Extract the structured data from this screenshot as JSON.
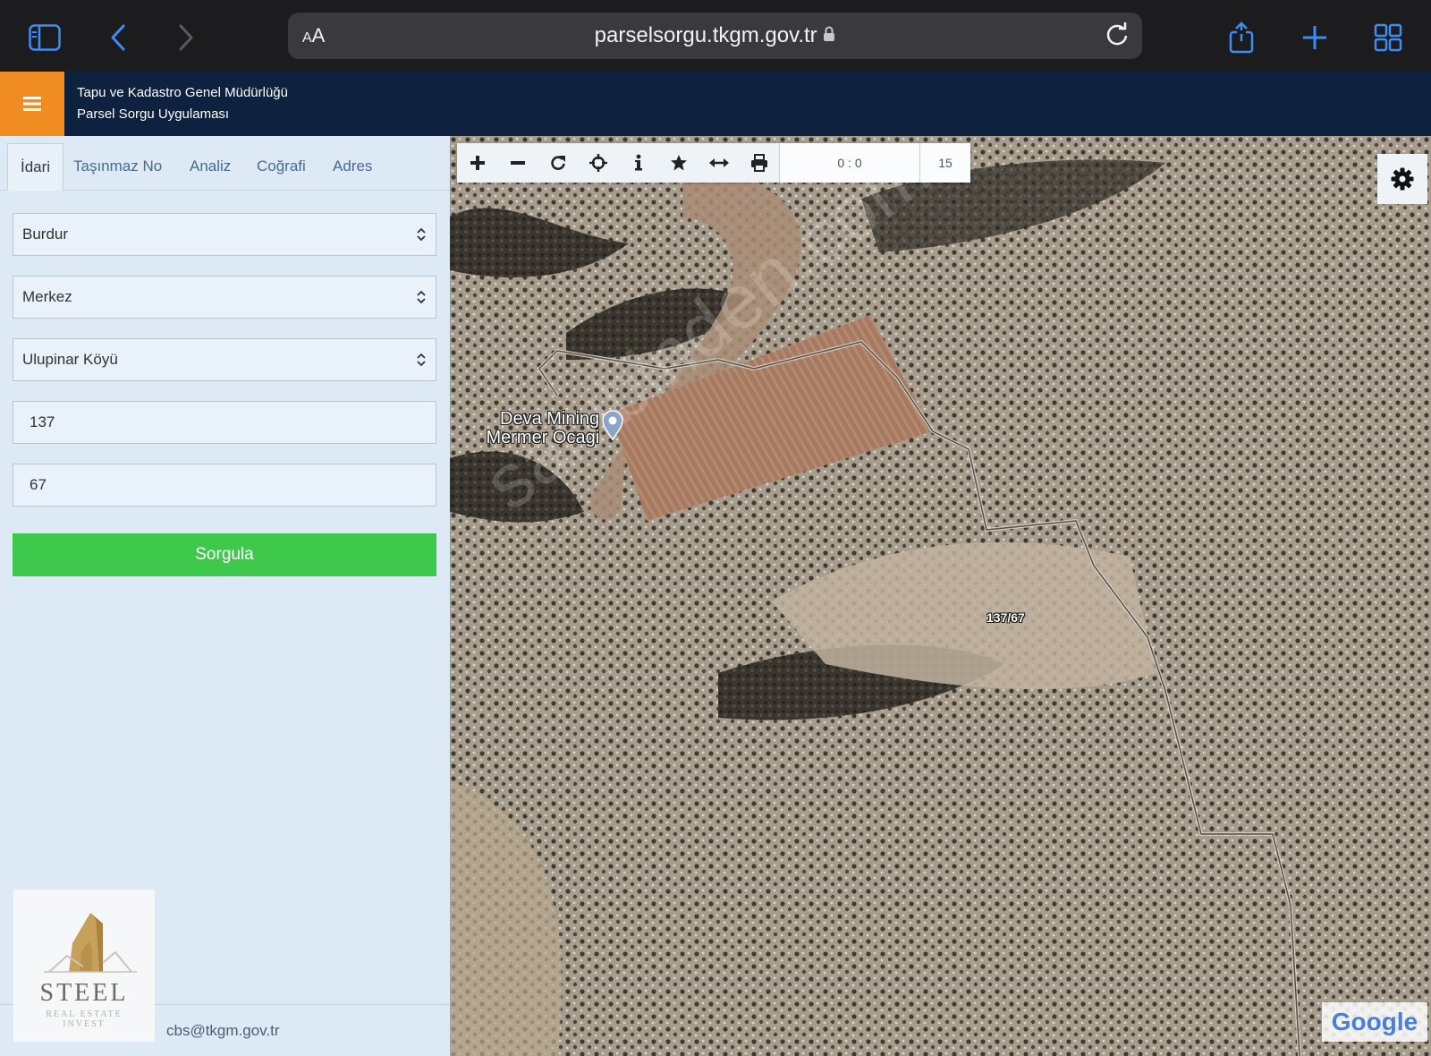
{
  "browser": {
    "aa_label_big": "A",
    "aa_label_small": "A",
    "url": "parselsorgu.tkgm.gov.tr"
  },
  "header": {
    "title_line1": "Tapu ve Kadastro Genel Müdürlüğü",
    "title_line2": "Parsel Sorgu Uygulaması"
  },
  "tabs": [
    "İdari",
    "Taşınmaz No",
    "Analiz",
    "Coğrafi",
    "Adres"
  ],
  "form": {
    "province": "Burdur",
    "district": "Merkez",
    "village": "Ulupinar Köyü",
    "block_no": "137",
    "parcel_no": "67",
    "submit_label": "Sorgula"
  },
  "logo": {
    "name": "STEEL",
    "sub1": "REAL ESTATE",
    "sub2": "INVEST"
  },
  "footer": {
    "email": "cbs@tkgm.gov.tr"
  },
  "map": {
    "coords": "0 : 0",
    "zoom": "15",
    "place_label_line1": "Deva Mining",
    "place_label_line2": "Mermer Ocagi",
    "parcel_label": "137/67",
    "watermark": "sahibinden.com",
    "attribution": "Google"
  },
  "colors": {
    "header_bg": "#0e213f",
    "menu_orange": "#f18c22",
    "submit_green": "#3ec94c"
  }
}
